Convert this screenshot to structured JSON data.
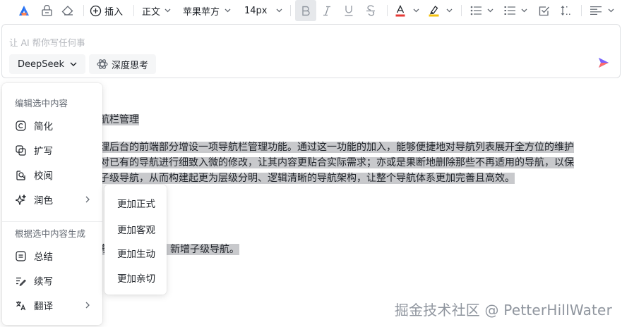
{
  "toolbar": {
    "insert_label": "插入",
    "paragraph_style": "正文",
    "font_family": "苹果苹方",
    "font_size": "14px",
    "text_color": "#e53935",
    "highlight_color": "#f4c20d"
  },
  "ai": {
    "placeholder": "让 AI 帮你写任何事",
    "model": "DeepSeek",
    "think_label": "深度思考"
  },
  "document": {
    "heading_partial": "航栏管理",
    "para_line1": "理后台的前端部分增设一项导航栏管理功能。通过这一功能的加入，能够便捷地对导航列表展开全方位的维护",
    "para_line2": "对已有的导航进行细致入微的修改，让其内容更贴合实际需求；亦或是果断地删除那些不再适用的导航，以保",
    "para_line3": "子级导航，从而构建起更为层级分明、逻辑清晰的导航架构，让整个导航体系更加完善且高效。",
    "list_partial": "航，删除导航，新增子级导航。"
  },
  "menu": {
    "section_edit": "编辑选中内容",
    "simplify": "简化",
    "expand": "扩写",
    "proofread": "校阅",
    "polish": "润色",
    "section_generate": "根据选中内容生成",
    "summarize": "总结",
    "continue": "续写",
    "translate": "翻译"
  },
  "submenu": {
    "formal": "更加正式",
    "objective": "更加客观",
    "vivid": "更加生动",
    "friendly": "更加亲切"
  },
  "watermark": "掘金技术社区 @ PetterHillWater"
}
